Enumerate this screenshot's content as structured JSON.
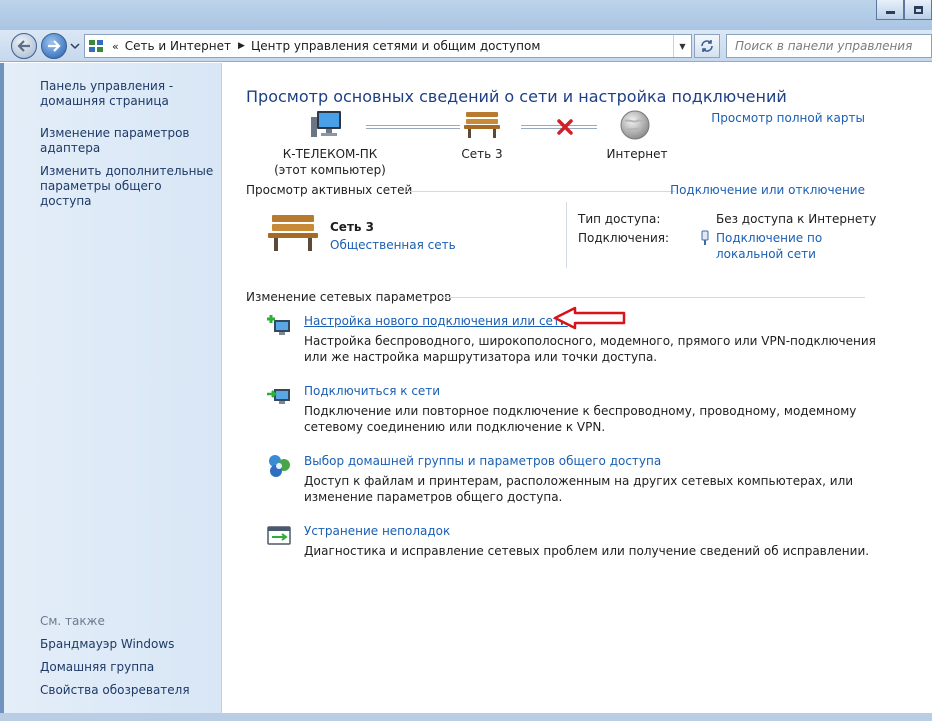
{
  "window": {
    "controls": {
      "minimize_icon": "minimize-icon",
      "maximize_icon": "maximize-icon"
    }
  },
  "nav": {
    "back_icon": "back-arrow-icon",
    "forward_icon": "forward-arrow-icon",
    "breadcrumb": [
      "Сеть и Интернет",
      "Центр управления сетями и общим доступом"
    ],
    "search_placeholder": "Поиск в панели управления"
  },
  "sidebar": {
    "home_link": "Панель управления - домашняя страница",
    "links": [
      "Изменение параметров адаптера",
      "Изменить дополнительные параметры общего доступа"
    ],
    "see_also_title": "См. также",
    "see_also": [
      "Брандмауэр Windows",
      "Домашняя группа",
      "Свойства обозревателя"
    ]
  },
  "main": {
    "title": "Просмотр основных сведений о сети и настройка подключений",
    "full_map_link": "Просмотр полной карты",
    "map": {
      "computer_name": "К-ТЕЛЕКОМ-ПК",
      "computer_sub": "(этот компьютер)",
      "network_name": "Сеть  3",
      "internet_label": "Интернет"
    },
    "active_networks": {
      "heading": "Просмотр активных сетей",
      "connect_link": "Подключение или отключение",
      "network_name": "Сеть  3",
      "network_type": "Общественная сеть",
      "access_type_label": "Тип доступа:",
      "access_type_value": "Без доступа к Интернету",
      "connections_label": "Подключения:",
      "connections_value_line1": "Подключение по",
      "connections_value_line2": "локальной сети"
    },
    "change_settings": {
      "heading": "Изменение сетевых параметров",
      "tasks": [
        {
          "title": "Настройка нового подключения или сети",
          "desc1": "Настройка беспроводного, широкополосного, модемного, прямого или VPN-подключения",
          "desc2": "или же настройка маршрутизатора или точки доступа."
        },
        {
          "title": "Подключиться к сети",
          "desc1": "Подключение или повторное подключение к беспроводному, проводному, модемному",
          "desc2": "сетевому соединению или подключение к VPN."
        },
        {
          "title": "Выбор домашней группы и параметров общего доступа",
          "desc1": "Доступ к файлам и принтерам, расположенным на других сетевых компьютерах, или",
          "desc2": "изменение параметров общего доступа."
        },
        {
          "title": "Устранение неполадок",
          "desc1": "Диагностика и исправление сетевых проблем или получение сведений об исправлении.",
          "desc2": ""
        }
      ]
    }
  },
  "colors": {
    "link": "#1a5fb4",
    "title": "#1e3f86",
    "annotation_arrow": "#d7141a",
    "sidebar_bg": "#dde9f6"
  }
}
